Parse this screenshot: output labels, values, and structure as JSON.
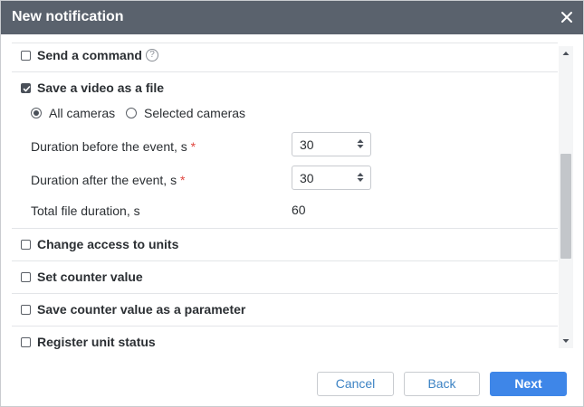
{
  "dialog": {
    "title": "New notification",
    "close_icon": "close-icon"
  },
  "actions": {
    "send_command": {
      "label": "Send a command",
      "checked": false,
      "help_icon": "question-circle-icon",
      "help_text": "?"
    },
    "save_video": {
      "label": "Save a video as a file",
      "checked": true,
      "cameras": {
        "options": [
          {
            "label": "All cameras",
            "selected": true
          },
          {
            "label": "Selected cameras",
            "selected": false
          }
        ]
      },
      "duration_before": {
        "label": "Duration before the event, s",
        "required_mark": "*",
        "value": "30"
      },
      "duration_after": {
        "label": "Duration after the event, s",
        "required_mark": "*",
        "value": "30"
      },
      "total": {
        "label": "Total file duration, s",
        "value": "60"
      }
    },
    "change_access": {
      "label": "Change access to units",
      "checked": false
    },
    "set_counter": {
      "label": "Set counter value",
      "checked": false
    },
    "save_counter_param": {
      "label": "Save counter value as a parameter",
      "checked": false
    },
    "register_status": {
      "label": "Register unit status",
      "checked": false
    }
  },
  "footer": {
    "cancel": "Cancel",
    "back": "Back",
    "next": "Next"
  },
  "colors": {
    "titlebar": "#5a626d",
    "primary": "#3e86e8",
    "link": "#3d83c4",
    "required": "#e0463f"
  }
}
